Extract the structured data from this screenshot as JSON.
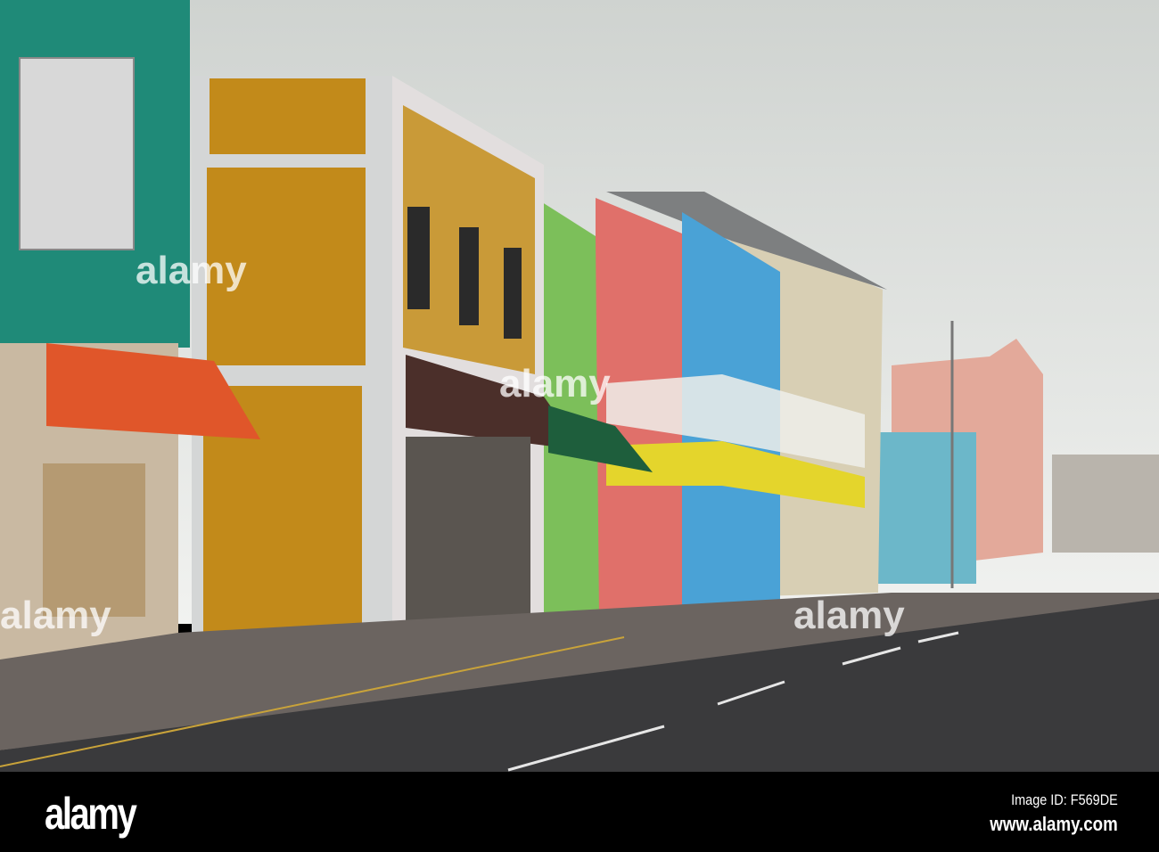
{
  "photo": {
    "watermark": "alamy",
    "colors": {
      "sky": "#dfe1df",
      "teal": "#1f8a78",
      "mustard": "#c28a1a",
      "yellow_bldg": "#c99a38",
      "green": "#7cbf5a",
      "red": "#e0706a",
      "blue": "#4aa2d6",
      "cream": "#d8cfb4",
      "road": "#3a3a3c"
    }
  },
  "footer": {
    "logo": "alamy",
    "image_id": "Image ID: F569DE",
    "url": "www.alamy.com"
  }
}
